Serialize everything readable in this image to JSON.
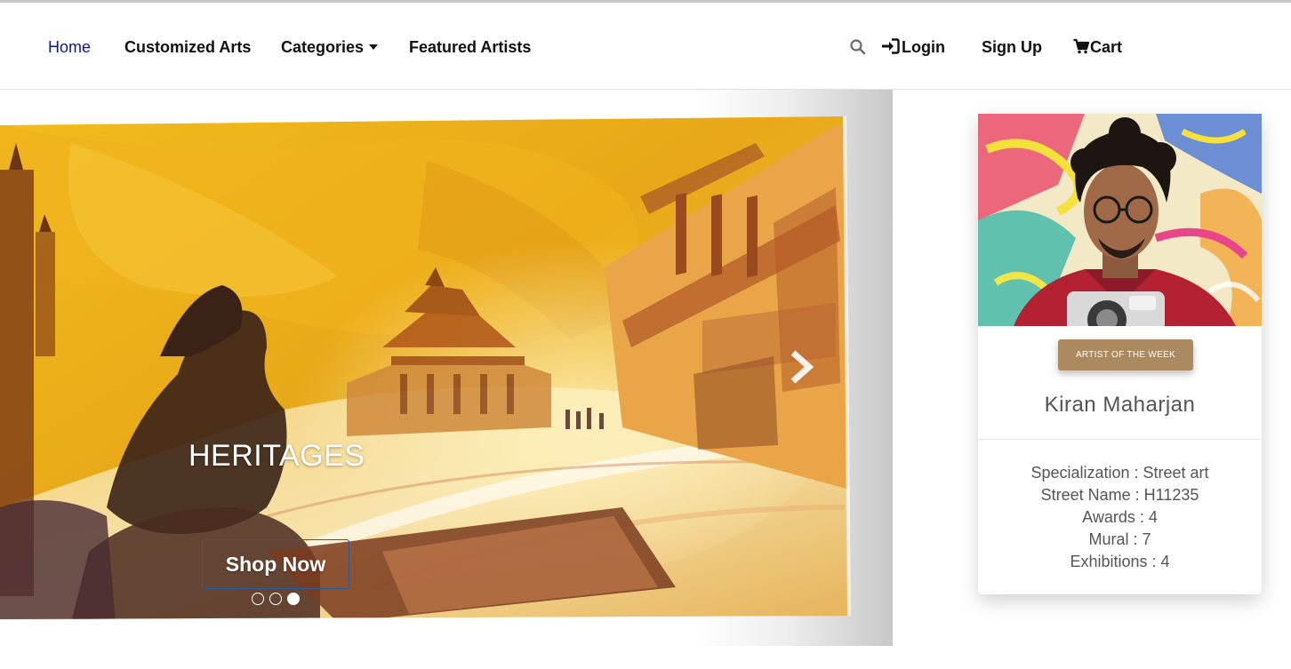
{
  "nav": {
    "home": "Home",
    "customized_arts": "Customized Arts",
    "categories": "Categories",
    "featured_artists": "Featured Artists",
    "login": "Login",
    "sign_up": "Sign Up",
    "cart": "Cart",
    "icons": [
      "search-icon",
      "login-icon",
      "cart-icon",
      "caret-down-icon"
    ]
  },
  "hero": {
    "title": "HERITAGES",
    "button_label": "Shop Now",
    "slide_count": 3,
    "active_slide": 3
  },
  "artist_card": {
    "badge": "ARTIST OF THE WEEK",
    "name": "Kiran Maharjan",
    "details": [
      "Specialization : Street art",
      "Street Name : H11235",
      "Awards : 4",
      "Mural : 7",
      "Exhibitions : 4"
    ]
  },
  "colors": {
    "nav_active": "#0b1a8a",
    "badge": "#ab8a5f",
    "text_muted": "#555555"
  }
}
